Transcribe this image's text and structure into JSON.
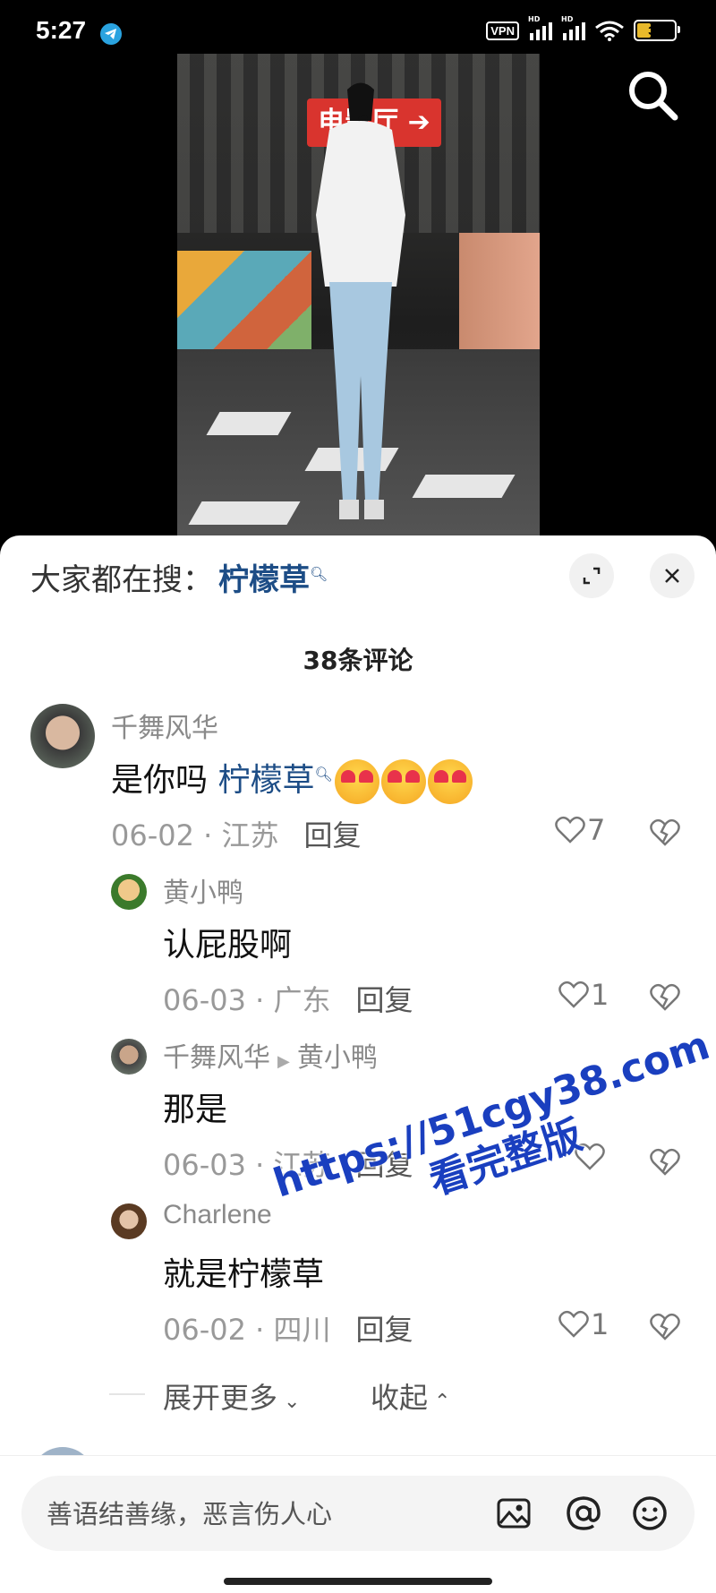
{
  "status_bar": {
    "time": "5:27",
    "vpn_label": "VPN",
    "signal_label": "HD",
    "battery": "39"
  },
  "video": {
    "sign_text": "电影厅"
  },
  "sheet": {
    "hot_search_prefix": "大家都在搜：",
    "hot_search_keyword": "柠檬草",
    "comment_count": "38条评论"
  },
  "comments": [
    {
      "user": "千舞风华",
      "text_prefix": "是你吗 ",
      "keyword": "柠檬草",
      "emoji_count": 3,
      "date_loc": "06-02 · 江苏",
      "reply_label": "回复",
      "likes": "7"
    }
  ],
  "replies": [
    {
      "user": "黄小鸭",
      "text": "认屁股啊",
      "date_loc": "06-03 · 广东",
      "reply_label": "回复",
      "likes": "1"
    },
    {
      "user": "千舞风华",
      "reply_to": "黄小鸭",
      "text": "那是",
      "date_loc": "06-03 · 江苏",
      "reply_label": "回复",
      "likes": ""
    },
    {
      "user": "Charlene",
      "text": "就是柠檬草",
      "date_loc": "06-02 · 四川",
      "reply_label": "回复",
      "likes": "1"
    }
  ],
  "thread_controls": {
    "expand_more": "展开更多",
    "collapse": "收起"
  },
  "watermark": {
    "line1": "https://51cgy38.com",
    "line2": "看完整版"
  },
  "input_bar": {
    "placeholder": "善语结善缘，恶言伤人心"
  },
  "colors": {
    "keyword_blue": "#1d4d86",
    "watermark_blue": "#1a3fbf"
  }
}
